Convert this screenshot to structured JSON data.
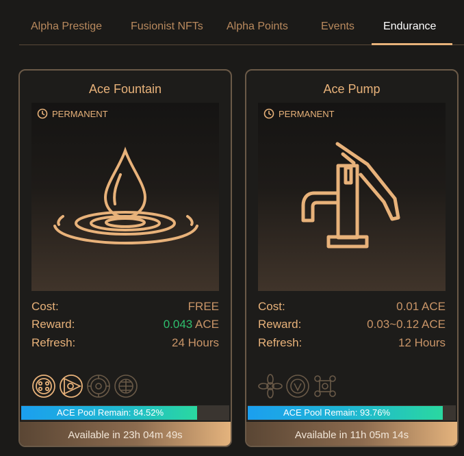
{
  "tabs": [
    {
      "label": "Alpha Prestige",
      "active": false
    },
    {
      "label": "Fusionist NFTs",
      "active": false
    },
    {
      "label": "Alpha Points",
      "active": false
    },
    {
      "label": "Events",
      "active": false
    },
    {
      "label": "Endurance",
      "active": true
    }
  ],
  "cards": [
    {
      "title": "Ace Fountain",
      "badge": "PERMANENT",
      "icon": "water-drop-icon",
      "cost_label": "Cost:",
      "cost_value": "FREE",
      "reward_label": "Reward:",
      "reward_amount": "0.043",
      "reward_unit": "ACE",
      "refresh_label": "Refresh:",
      "refresh_value": "24 Hours",
      "pool_text": "ACE Pool Remain: 84.52%",
      "pool_percent": 84.52,
      "available_text": "Available in 23h 04m 49s",
      "badges": [
        "ring-emblem-icon",
        "triangle-emblem-icon",
        "gear-emblem-icon",
        "globe-emblem-icon"
      ]
    },
    {
      "title": "Ace Pump",
      "badge": "PERMANENT",
      "icon": "water-pump-icon",
      "cost_label": "Cost:",
      "cost_value": "0.01 ACE",
      "reward_label": "Reward:",
      "reward_value": "0.03~0.12 ACE",
      "refresh_label": "Refresh:",
      "refresh_value": "12 Hours",
      "pool_text": "ACE Pool Remain: 93.76%",
      "pool_percent": 93.76,
      "available_text": "Available in 11h 05m 14s",
      "badges": [
        "flower-emblem-icon",
        "shield-emblem-icon",
        "chain-emblem-icon"
      ]
    }
  ],
  "colors": {
    "accent": "#e8b27a",
    "green": "#2fbf6e",
    "pool_start": "#1b9fef",
    "pool_end": "#2ad8a0"
  }
}
